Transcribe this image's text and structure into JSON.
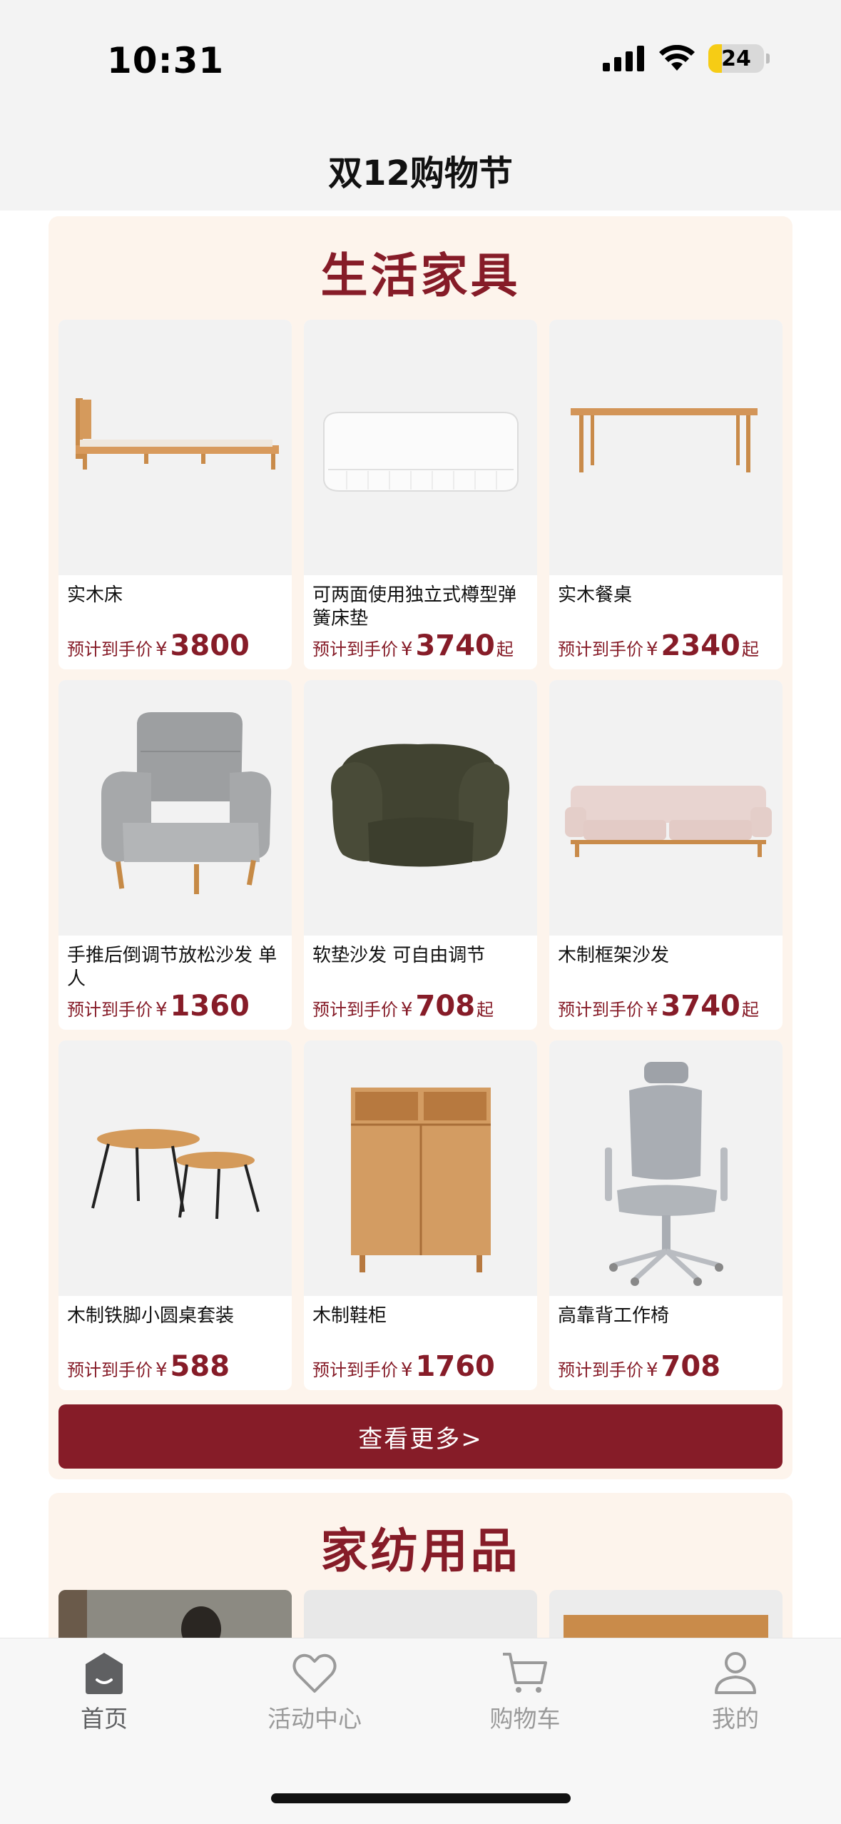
{
  "status": {
    "time": "10:31",
    "battery": "24",
    "icons": [
      "signal-icon",
      "wifi-icon",
      "battery-icon"
    ]
  },
  "header": {
    "title": "双12购物节"
  },
  "section1": {
    "title": "生活家具",
    "more_label": "查看更多>",
    "price_prefix": "预计到手价",
    "currency": "¥",
    "products": [
      {
        "name": "实木床",
        "price": "3800",
        "suffix": "",
        "image": "wooden-bed"
      },
      {
        "name": "可两面使用独立式樽型弹簧床垫",
        "price": "3740",
        "suffix": "起",
        "image": "mattress"
      },
      {
        "name": "实木餐桌",
        "price": "2340",
        "suffix": "起",
        "image": "dining-table"
      },
      {
        "name": "手推后倒调节放松沙发 单人",
        "price": "1360",
        "suffix": "",
        "image": "recliner-chair"
      },
      {
        "name": "软垫沙发 可自由调节",
        "price": "708",
        "suffix": "起",
        "image": "soft-sofa"
      },
      {
        "name": "木制框架沙发",
        "price": "3740",
        "suffix": "起",
        "image": "wood-frame-sofa"
      },
      {
        "name": "木制铁脚小圆桌套装",
        "price": "588",
        "suffix": "",
        "image": "round-tables"
      },
      {
        "name": "木制鞋柜",
        "price": "1760",
        "suffix": "",
        "image": "shoe-cabinet"
      },
      {
        "name": "高靠背工作椅",
        "price": "708",
        "suffix": "",
        "image": "office-chair"
      }
    ]
  },
  "section2": {
    "title": "家纺用品"
  },
  "tabs": [
    {
      "label": "首页",
      "icon": "home-icon",
      "active": true
    },
    {
      "label": "活动中心",
      "icon": "heart-icon",
      "active": false
    },
    {
      "label": "购物车",
      "icon": "cart-icon",
      "active": false
    },
    {
      "label": "我的",
      "icon": "user-icon",
      "active": false
    }
  ],
  "colors": {
    "accent": "#861c28",
    "section_bg": "#fdf4ec",
    "nav_bg": "#f3f3f3"
  }
}
